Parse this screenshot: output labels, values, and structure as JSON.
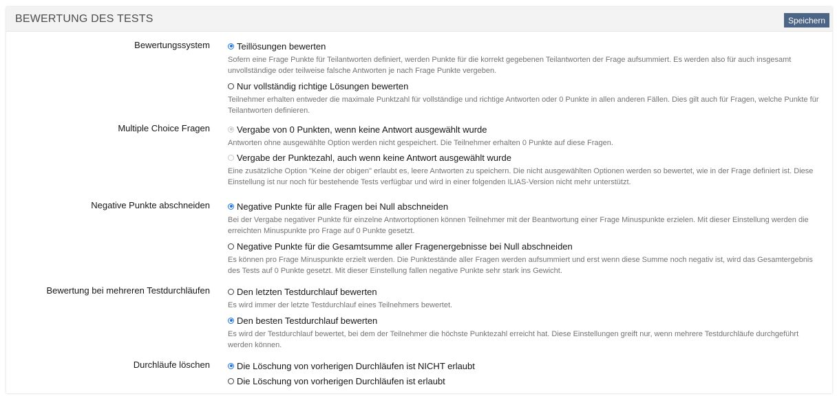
{
  "header": {
    "title": "BEWERTUNG DES TESTS",
    "save_label": "Speichern"
  },
  "colors": {
    "accent": "#1a73e8",
    "button": "#4c6586",
    "header_bg": "#f3f3f3",
    "description_text": "#737373"
  },
  "sections": [
    {
      "label": "Bewertungssystem",
      "options": [
        {
          "label": "Teillösungen bewerten",
          "checked": true,
          "disabled": false,
          "description": "Sofern eine Frage Punkte für Teilantworten definiert, werden Punkte für die korrekt gegebenen Teilantworten der Frage aufsummiert. Es werden also für auch insgesamt unvollständige oder teilweise falsche Antworten je nach Frage Punkte vergeben."
        },
        {
          "label": "Nur vollständig richtige Lösungen bewerten",
          "checked": false,
          "disabled": false,
          "description": "Teilnehmer erhalten entweder die maximale Punktzahl für vollständige und richtige Antworten oder 0 Punkte in allen anderen Fällen. Dies gilt auch für Fragen, welche Punkte für Teilantworten definieren."
        }
      ]
    },
    {
      "label": "Multiple Choice Fragen",
      "options": [
        {
          "label": "Vergabe von 0 Punkten, wenn keine Antwort ausgewählt wurde",
          "checked": true,
          "disabled": true,
          "description": "Antworten ohne ausgewählte Option werden nicht gespeichert. Die Teilnehmer erhalten 0 Punkte auf diese Fragen."
        },
        {
          "label": "Vergabe der Punktezahl, auch wenn keine Antwort ausgewählt wurde",
          "checked": false,
          "disabled": true,
          "description": "Eine zusätzliche Option \"Keine der obigen\" erlaubt es, leere Antworten zu speichern. Die nicht ausgewählten Optionen werden so bewertet, wie in der Frage definiert ist. Diese Einstellung ist nur noch für bestehende Tests verfügbar und wird in einer folgenden ILIAS-Version nicht mehr unterstützt."
        }
      ]
    },
    {
      "label": "Negative Punkte abschneiden",
      "options": [
        {
          "label": "Negative Punkte für alle Fragen bei Null abschneiden",
          "checked": true,
          "disabled": false,
          "description": "Bei der Vergabe negativer Punkte für einzelne Antwortoptionen können Teilnehmer mit der Beantwortung einer Frage Minuspunkte erzielen. Mit dieser Einstellung werden die erreichten Minuspunkte pro Frage auf 0 Punkte gesetzt."
        },
        {
          "label": "Negative Punkte für die Gesamtsumme aller Fragenergebnisse bei Null abschneiden",
          "checked": false,
          "disabled": false,
          "description": "Es können pro Frage Minuspunkte erzielt werden. Die Punktestände aller Fragen werden aufsummiert und erst wenn diese Summe noch negativ ist, wird das Gesamtergebnis des Tests auf 0 Punkte gesetzt. Mit dieser Einstellung fallen negative Punkte sehr stark ins Gewicht."
        }
      ]
    },
    {
      "label": "Bewertung bei mehreren Testdurchläufen",
      "options": [
        {
          "label": "Den letzten Testdurchlauf bewerten",
          "checked": false,
          "disabled": false,
          "description": "Es wird immer der letzte Testdurchlauf eines Teilnehmers bewertet."
        },
        {
          "label": "Den besten Testdurchlauf bewerten",
          "checked": true,
          "disabled": false,
          "description": "Es wird der Testdurchlauf bewertet, bei dem der Teilnehmer die höchste Punktezahl erreicht hat. Diese Einstellungen greift nur, wenn mehrere Testdurchläufe durchgeführt werden können."
        }
      ]
    },
    {
      "label": "Durchläufe löschen",
      "options": [
        {
          "label": "Die Löschung von vorherigen Durchläufen ist NICHT erlaubt",
          "checked": true,
          "disabled": false,
          "description": ""
        },
        {
          "label": "Die Löschung von vorherigen Durchläufen ist erlaubt",
          "checked": false,
          "disabled": false,
          "description": ""
        }
      ]
    }
  ]
}
